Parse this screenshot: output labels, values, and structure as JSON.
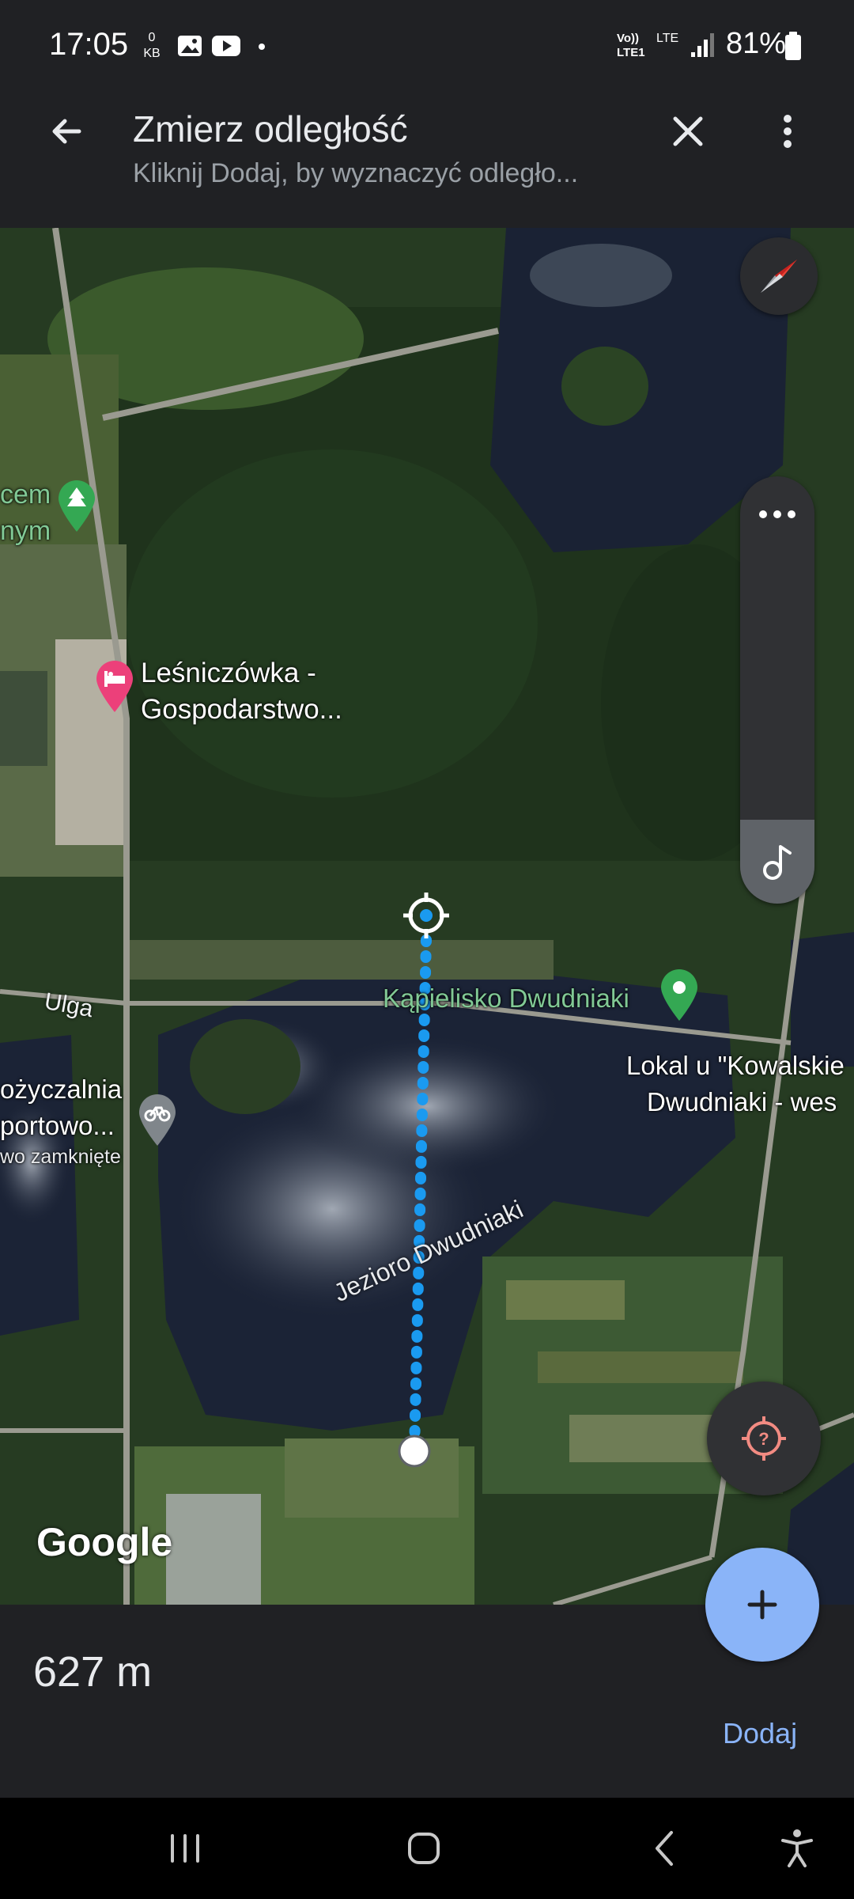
{
  "status_bar": {
    "time": "17:05",
    "data_rate_value": "0",
    "data_rate_unit": "KB",
    "network_label": "Vo)) LTE1",
    "lte_label": "LTE",
    "battery_percent": "81%"
  },
  "header": {
    "title": "Zmierz odległość",
    "subtitle": "Kliknij Dodaj, by wyznaczyć odległo..."
  },
  "map": {
    "labels": {
      "top_left_line1": "cem",
      "top_left_line2": "nym",
      "lesniczowka_line1": "Leśniczówka -",
      "lesniczowka_line2": "Gospodarstwo...",
      "kapielisko": "Kąpielisko Dwudniaki",
      "lokal_line1": "Lokal u \"Kowalskie",
      "lokal_line2": "Dwudniaki - wes",
      "wypozyczalnia_line1": "ożyczalnia",
      "wypozyczalnia_line2": "portowo...",
      "wypozyczalnia_line3": "wo zamknięte",
      "road_ulga": "Ulga",
      "lake": "Jezioro Dwudniaki"
    },
    "attribution": "Google",
    "accent_color": "#1a9af0"
  },
  "measurement": {
    "distance": "627 m",
    "add_label": "Dodaj"
  }
}
